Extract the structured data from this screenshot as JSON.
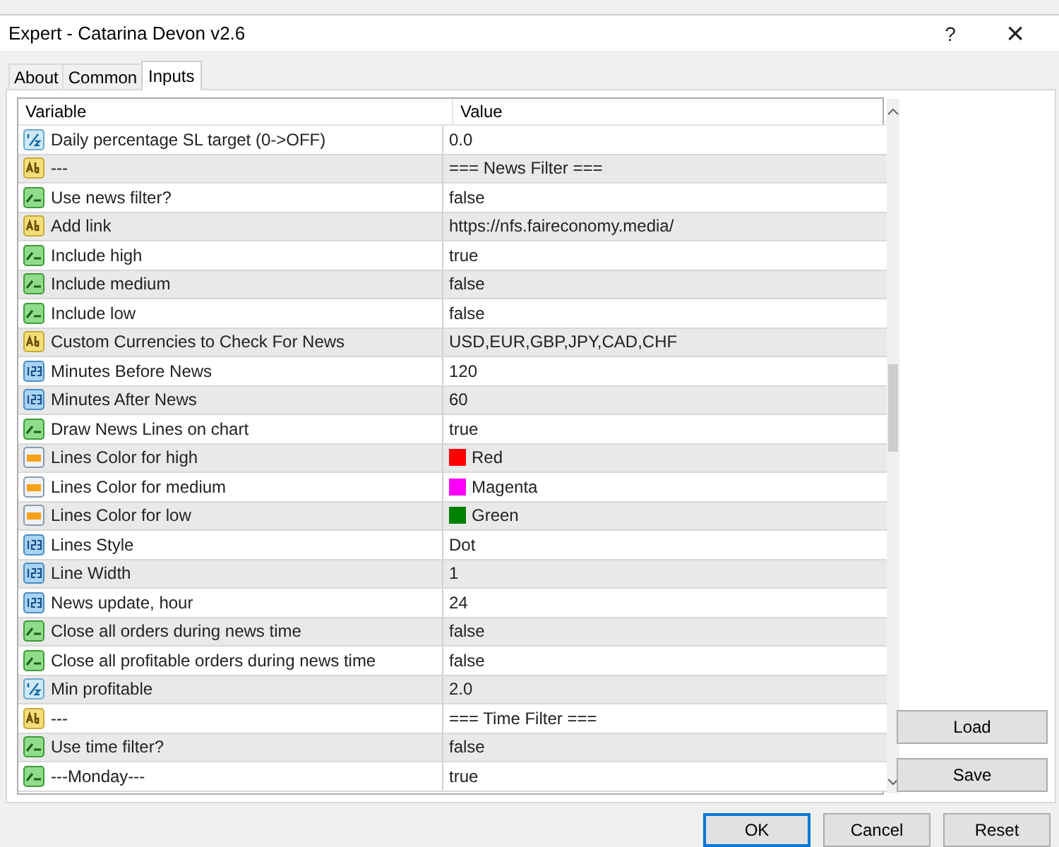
{
  "window": {
    "title": "Expert - Catarina Devon v2.6",
    "help": "?",
    "close": "×"
  },
  "tabs": [
    {
      "label": "About",
      "selected": false
    },
    {
      "label": "Common",
      "selected": false
    },
    {
      "label": "Inputs",
      "selected": true
    }
  ],
  "table": {
    "columns": [
      "Variable",
      "Value"
    ],
    "rows": [
      {
        "kind": "double",
        "variable": "Daily percentage SL target (0->OFF)",
        "value": "0.0"
      },
      {
        "kind": "string",
        "variable": "---",
        "value": "=== News Filter ==="
      },
      {
        "kind": "bool",
        "variable": "Use news filter?",
        "value": "false"
      },
      {
        "kind": "string",
        "variable": "Add link",
        "value": "https://nfs.faireconomy.media/"
      },
      {
        "kind": "bool",
        "variable": "Include high",
        "value": "true"
      },
      {
        "kind": "bool",
        "variable": "Include medium",
        "value": "false"
      },
      {
        "kind": "bool",
        "variable": "Include low",
        "value": "false"
      },
      {
        "kind": "string",
        "variable": "Custom Currencies to Check For News",
        "value": "USD,EUR,GBP,JPY,CAD,CHF"
      },
      {
        "kind": "int",
        "variable": "Minutes Before News",
        "value": "120"
      },
      {
        "kind": "int",
        "variable": "Minutes After News",
        "value": "60"
      },
      {
        "kind": "bool",
        "variable": "Draw News Lines on chart",
        "value": "true"
      },
      {
        "kind": "color",
        "variable": "Lines Color for high",
        "value": "Red",
        "color": "#ff0000"
      },
      {
        "kind": "color",
        "variable": "Lines Color for medium",
        "value": "Magenta",
        "color": "#ff00ff"
      },
      {
        "kind": "color",
        "variable": "Lines Color for low",
        "value": "Green",
        "color": "#008000"
      },
      {
        "kind": "int",
        "variable": "Lines Style",
        "value": "Dot"
      },
      {
        "kind": "int",
        "variable": "Line Width",
        "value": "1"
      },
      {
        "kind": "int",
        "variable": "News update, hour",
        "value": "24"
      },
      {
        "kind": "bool",
        "variable": "Close all orders during news time",
        "value": "false"
      },
      {
        "kind": "bool",
        "variable": "Close all profitable orders during news time",
        "value": "false"
      },
      {
        "kind": "double",
        "variable": "Min profitable",
        "value": "2.0"
      },
      {
        "kind": "string",
        "variable": "---",
        "value": "=== Time Filter ==="
      },
      {
        "kind": "bool",
        "variable": "Use time filter?",
        "value": "false"
      },
      {
        "kind": "bool",
        "variable": "---Monday---",
        "value": "true"
      }
    ]
  },
  "side_buttons": [
    "Load",
    "Save"
  ],
  "buttons": [
    {
      "label": "OK",
      "default": true
    },
    {
      "label": "Cancel",
      "default": false
    },
    {
      "label": "Reset",
      "default": false
    }
  ]
}
